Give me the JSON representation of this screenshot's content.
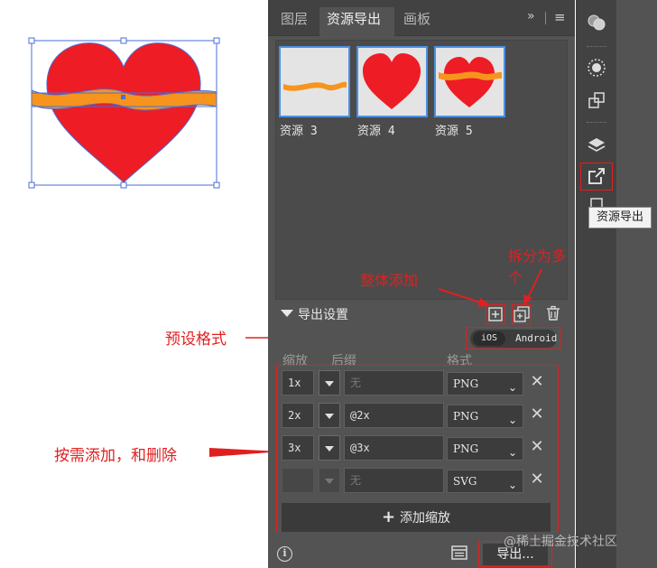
{
  "panel": {
    "tabs": [
      {
        "label": "图层"
      },
      {
        "label": "资源导出"
      },
      {
        "label": "画板"
      }
    ],
    "more_glyph": "»",
    "menu_glyph": "≡",
    "assets": [
      {
        "label": "资源 3"
      },
      {
        "label": "资源 4"
      },
      {
        "label": "资源 5"
      }
    ],
    "export_settings": {
      "title": "导出设置",
      "presets": {
        "ios": "iOS",
        "android": "Android"
      },
      "columns": {
        "scale": "缩放",
        "suffix": "后缀",
        "format": "格式"
      },
      "rows": [
        {
          "scale": "1x",
          "suffix": "",
          "suffix_placeholder": "无",
          "format": "PNG"
        },
        {
          "scale": "2x",
          "suffix": "@2x",
          "suffix_placeholder": "",
          "format": "PNG"
        },
        {
          "scale": "3x",
          "suffix": "@3x",
          "suffix_placeholder": "",
          "format": "PNG"
        },
        {
          "scale": "",
          "suffix": "",
          "suffix_placeholder": "无",
          "format": "SVG"
        }
      ],
      "add_scale_label": "添加缩放",
      "export_label": "导出..."
    }
  },
  "toolbar": {
    "tooltip": "资源导出"
  },
  "annotations": {
    "whole_add": "整体添加",
    "split_multiple": "拆分为多个",
    "preset_format": "预设格式",
    "add_delete": "按需添加，和删除"
  },
  "watermark": "@稀土掘金技术社区",
  "colors": {
    "heart": "#ee1c25",
    "ribbon": "#f7941d",
    "selection": "#4a6fd8",
    "annotation": "#e02020",
    "thumb_border": "#4a90e2"
  }
}
